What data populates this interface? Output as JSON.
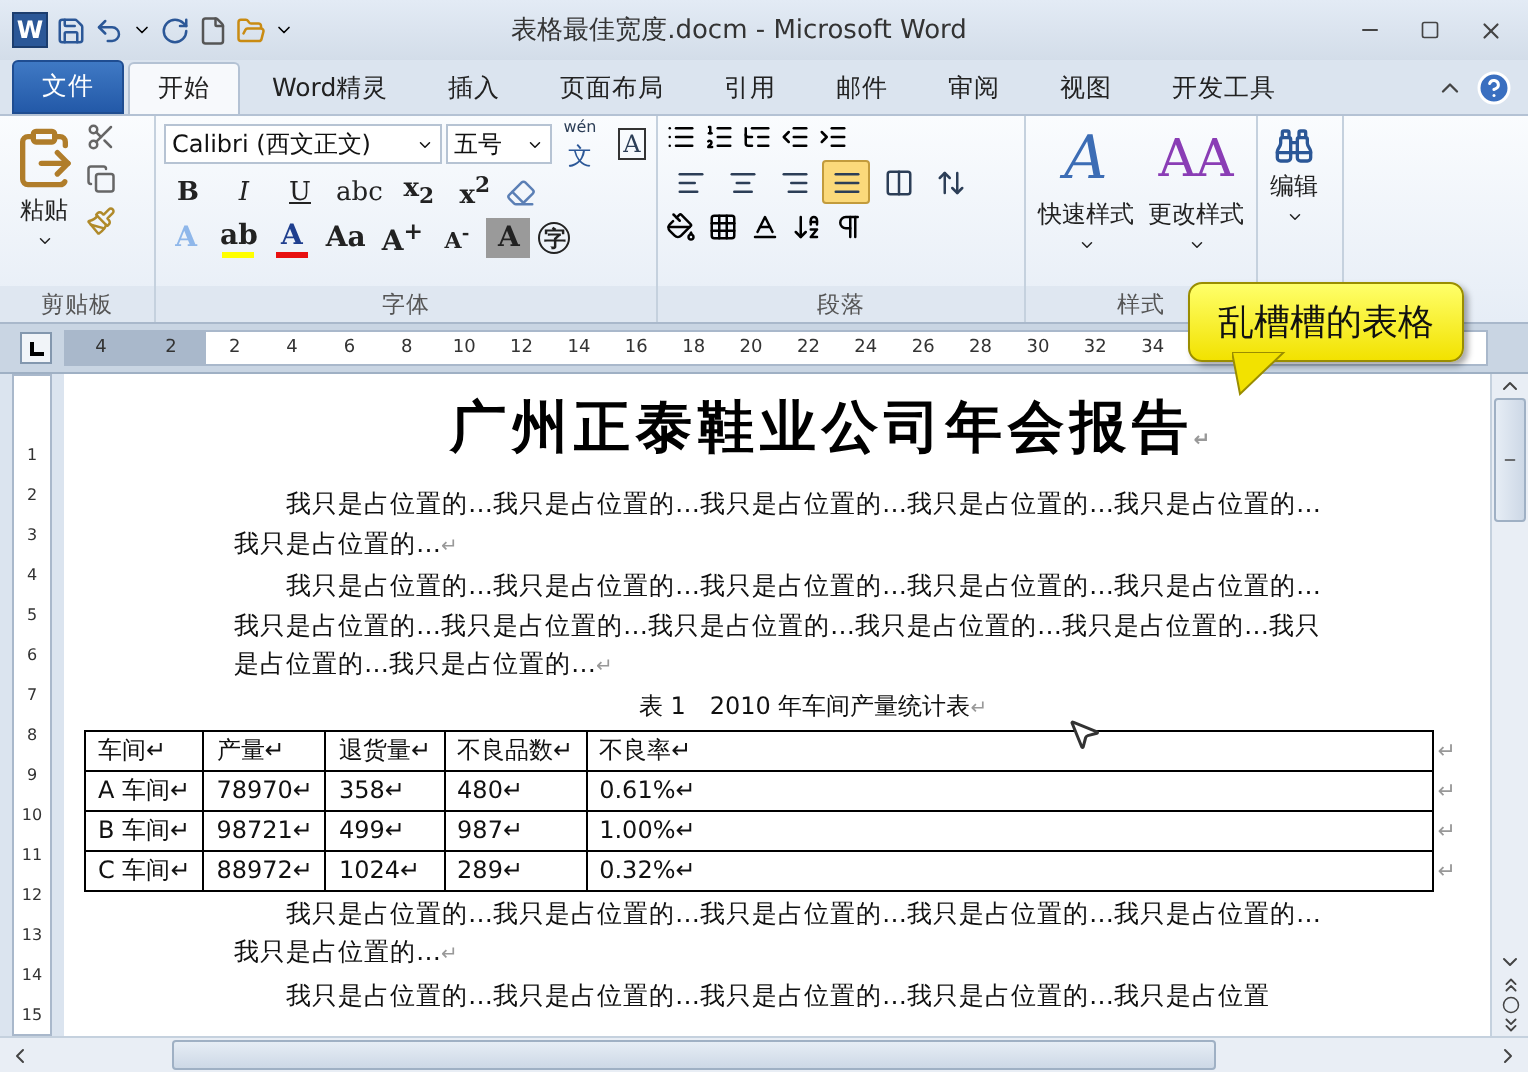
{
  "window": {
    "title": "表格最佳宽度.docm - Microsoft Word",
    "app_letter": "W"
  },
  "tabs": [
    {
      "label": "文件",
      "kind": "file",
      "selected": false
    },
    {
      "label": "开始",
      "kind": "tab",
      "selected": true
    },
    {
      "label": "Word精灵",
      "kind": "tab",
      "selected": false
    },
    {
      "label": "插入",
      "kind": "tab",
      "selected": false
    },
    {
      "label": "页面布局",
      "kind": "tab",
      "selected": false
    },
    {
      "label": "引用",
      "kind": "tab",
      "selected": false
    },
    {
      "label": "邮件",
      "kind": "tab",
      "selected": false
    },
    {
      "label": "审阅",
      "kind": "tab",
      "selected": false
    },
    {
      "label": "视图",
      "kind": "tab",
      "selected": false
    },
    {
      "label": "开发工具",
      "kind": "tab",
      "selected": false
    }
  ],
  "clipboard": {
    "label": "剪贴板",
    "paste": "粘贴"
  },
  "font": {
    "label": "字体",
    "font_name": "Calibri (西文正文)",
    "font_size": "五号",
    "phonetic_top": "wén",
    "phonetic": "文",
    "char_border": "A",
    "row2": [
      {
        "label": "B",
        "kind": "bold"
      },
      {
        "label": "I",
        "kind": "italic"
      },
      {
        "label": "U",
        "kind": "underline"
      },
      {
        "label": "abc",
        "kind": "strike"
      },
      {
        "label": "x$_{2}$",
        "kind": "plain"
      },
      {
        "label": "x$^{2}$",
        "kind": "plain"
      }
    ],
    "row3": [
      {
        "label": "A",
        "kind": "effect"
      },
      {
        "label": "ab",
        "kind": "highlight",
        "color": "#ffff00"
      },
      {
        "label": "A",
        "kind": "fontcolor",
        "color": "#e81010"
      },
      {
        "label": "Aa",
        "kind": "plain"
      },
      {
        "label": "A$^{+}$",
        "kind": "plain"
      },
      {
        "label": "A$^{-}$",
        "kind": "small"
      },
      {
        "label": "A",
        "kind": "shade"
      },
      {
        "label": "字",
        "kind": "circle"
      }
    ]
  },
  "paragraph": {
    "label": "段落",
    "justify_selected": true
  },
  "styles": {
    "label": "样式",
    "quick": "快速样式",
    "change": "更改样式",
    "quick_icon": "A",
    "change_icon": "AA"
  },
  "editing": {
    "label": "编辑"
  },
  "ruler": {
    "left_numbers": [
      "4",
      "2"
    ],
    "numbers": [
      "2",
      "4",
      "6",
      "8",
      "10",
      "12",
      "14",
      "16",
      "18",
      "20",
      "22",
      "24",
      "26",
      "28",
      "30",
      "32",
      "34"
    ]
  },
  "vertical_ruler": [
    "1",
    "2",
    "3",
    "4",
    "5",
    "6",
    "7",
    "8",
    "9",
    "10",
    "11",
    "12",
    "13",
    "14",
    "15"
  ],
  "callout": "乱槽槽的表格",
  "document": {
    "title": "广州正泰鞋业公司年会报告",
    "mark": "↵",
    "paragraphs_before": [
      {
        "text": "我只是占位置的…我只是占位置的…我只是占位置的…我只是占位置的…我只是占位置的…我只是占位置的…",
        "mark": "↵"
      },
      {
        "text": "我只是占位置的…我只是占位置的…我只是占位置的…我只是占位置的…我只是占位置的…我只是占位置的…我只是占位置的…我只是占位置的…我只是占位置的…我只是占位置的…我只是占位置的…我只是占位置的…",
        "mark": "↵"
      }
    ],
    "caption": "表 1　2010 年车间产量统计表",
    "caption_mark": "↵",
    "table": {
      "columns": [
        "车间↵",
        "产量↵",
        "退货量↵",
        "不良品数↵",
        "不良率↵"
      ],
      "rows": [
        [
          "A 车间↵",
          "78970↵",
          "358↵",
          "480↵",
          "0.61%↵"
        ],
        [
          "B 车间↵",
          "98721↵",
          "499↵",
          "987↵",
          "1.00%↵"
        ],
        [
          "C 车间↵",
          "88972↵",
          "1024↵",
          "289↵",
          "0.32%↵"
        ]
      ],
      "row_marks": [
        "↵",
        "↵",
        "↵",
        "↵"
      ]
    },
    "paragraphs_after": [
      {
        "text": "我只是占位置的…我只是占位置的…我只是占位置的…我只是占位置的…我只是占位置的…我只是占位置的…",
        "mark": "↵"
      },
      {
        "text": "我只是占位置的…我只是占位置的…我只是占位置的…我只是占位置的…我只是占位置"
      }
    ]
  }
}
